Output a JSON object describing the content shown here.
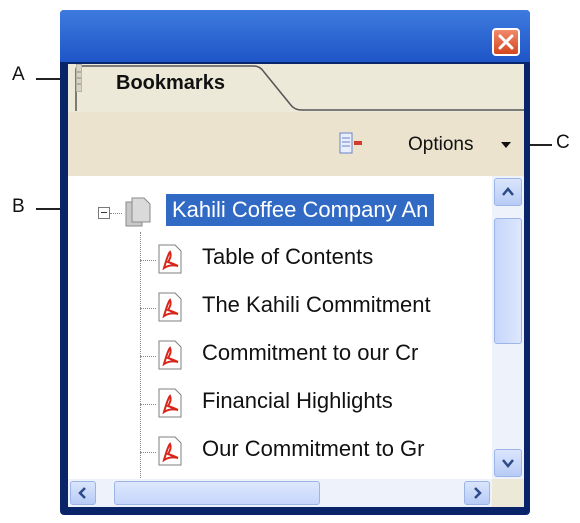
{
  "callouts": {
    "a": "A",
    "b": "B",
    "c": "C"
  },
  "window": {
    "close_icon": "close-icon"
  },
  "tab": {
    "label": "Bookmarks"
  },
  "toolbar": {
    "options_label": "Options",
    "options_icon": "bookmark-options-icon"
  },
  "tree": {
    "root": {
      "label": "Kahili Coffee Company An",
      "expanded": true,
      "selected": true
    },
    "items": [
      {
        "label": "Table of Contents"
      },
      {
        "label": "The Kahili Commitment"
      },
      {
        "label": "Commitment to our Cr"
      },
      {
        "label": "Financial Highlights"
      },
      {
        "label": "Our Commitment to Gr"
      }
    ]
  },
  "colors": {
    "selection": "#316ac5",
    "titlebar": "#2a63d4",
    "panel": "#ece9d8"
  }
}
